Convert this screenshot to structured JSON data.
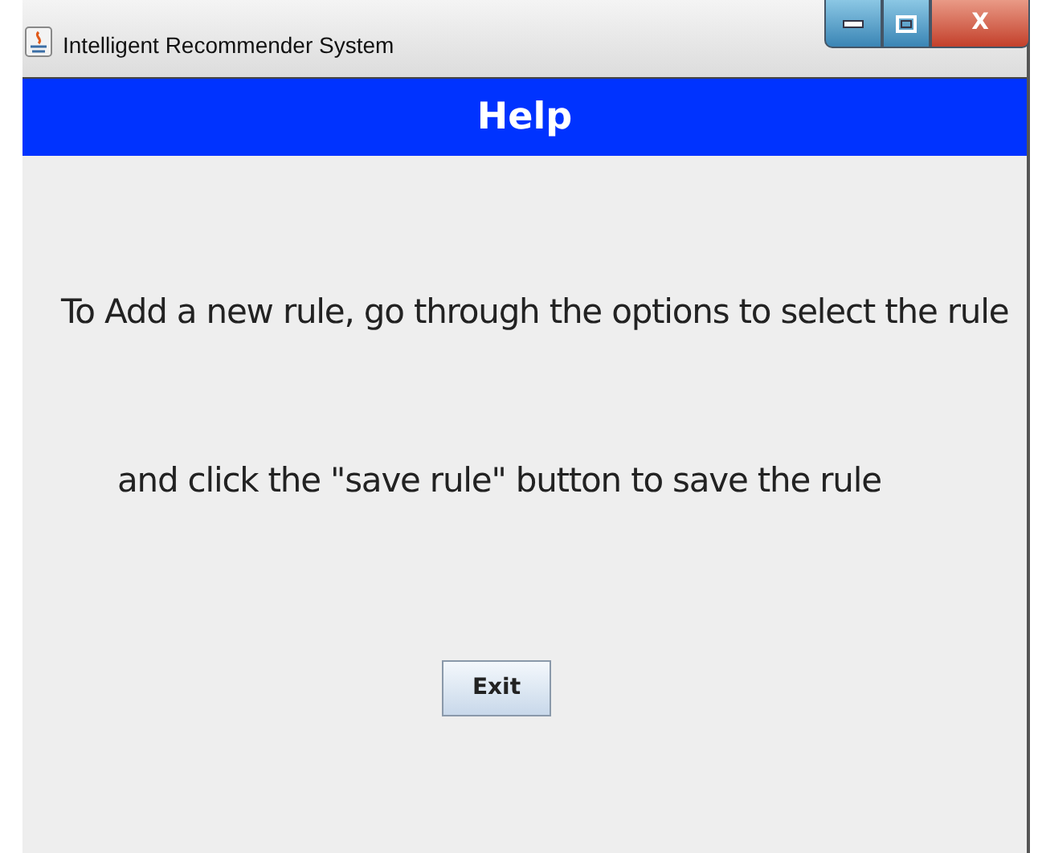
{
  "window": {
    "title": "Intelligent Recommender System",
    "close_label": "X"
  },
  "header": {
    "title": "Help"
  },
  "lines": [
    "To Add a new rule, go through the options to select the rule",
    "and click the \"save rule\" button to save the rule"
  ],
  "buttons": [
    {
      "label": "Exit"
    }
  ]
}
